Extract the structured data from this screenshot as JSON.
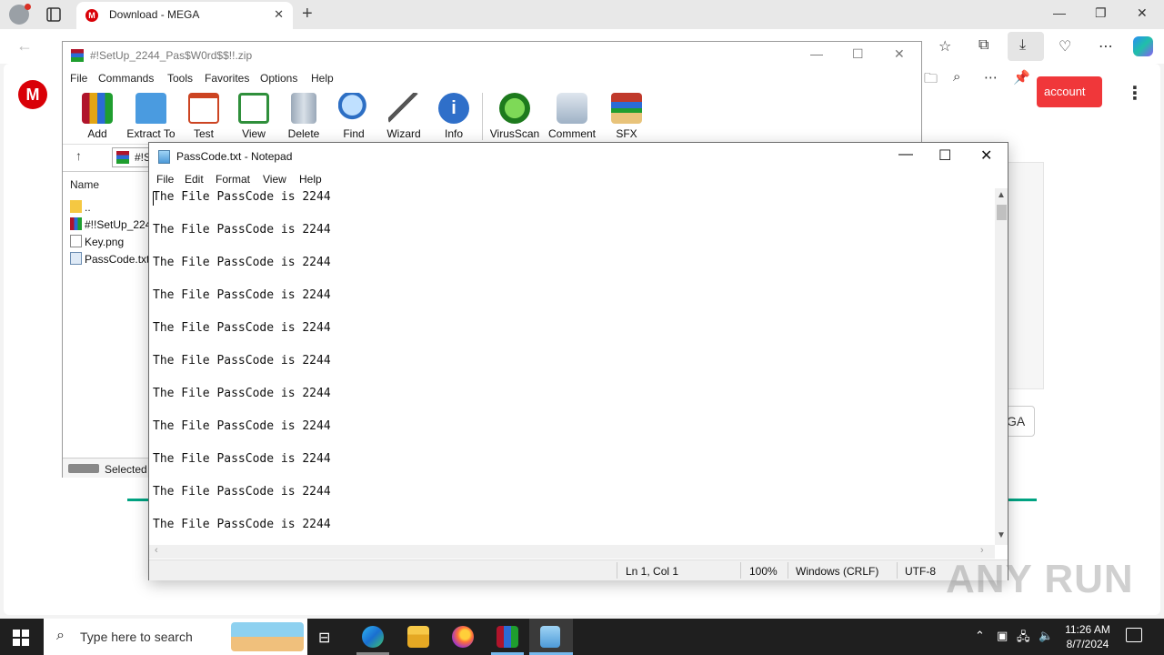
{
  "browser": {
    "tab_title": "Download - MEGA",
    "tab_close": "✕",
    "new_tab": "+",
    "account_button": "account",
    "partial_button": "GA",
    "mega_logo": "M"
  },
  "winrar": {
    "title": "#!SetUp_2244_Pas$W0rd$$!!.zip",
    "menu": [
      "File",
      "Commands",
      "Tools",
      "Favorites",
      "Options",
      "Help"
    ],
    "toolbar": [
      "Add",
      "Extract To",
      "Test",
      "View",
      "Delete",
      "Find",
      "Wizard",
      "Info",
      "VirusScan",
      "Comment",
      "SFX"
    ],
    "address": "#!S",
    "column_name": "Name",
    "files": [
      "..",
      "#!!SetUp_2244",
      "Key.png",
      "PassCode.txt"
    ],
    "status": "Selected"
  },
  "notepad": {
    "title": "PassCode.txt - Notepad",
    "menu": [
      "File",
      "Edit",
      "Format",
      "View",
      "Help"
    ],
    "lines": [
      "The File PassCode is 2244",
      "The File PassCode is 2244",
      "The File PassCode is 2244",
      "The File PassCode is 2244",
      "The File PassCode is 2244",
      "The File PassCode is 2244",
      "The File PassCode is 2244",
      "The File PassCode is 2244",
      "The File PassCode is 2244",
      "The File PassCode is 2244",
      "The File PassCode is 2244"
    ],
    "status": {
      "position": "Ln 1, Col 1",
      "zoom": "100%",
      "line_endings": "Windows (CRLF)",
      "encoding": "UTF-8"
    }
  },
  "watermark": "ANY RUN",
  "taskbar": {
    "search_placeholder": "Type here to search",
    "time": "11:26 AM",
    "date": "8/7/2024"
  },
  "colors": {
    "mega_red": "#d90007",
    "mega_green": "#00a382",
    "taskbar": "#1f1f1f"
  },
  "icons": {
    "winrar": "winrar-books-icon",
    "notepad": "notepad-icon",
    "edge": "edge-icon",
    "explorer": "folder-icon",
    "firefox": "firefox-icon"
  }
}
